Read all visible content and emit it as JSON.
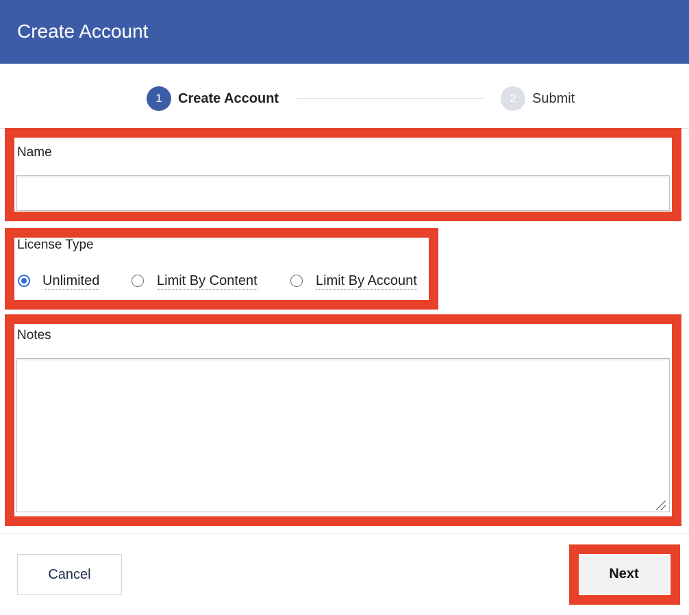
{
  "header": {
    "title": "Create Account"
  },
  "stepper": {
    "steps": [
      {
        "number": "1",
        "label": "Create Account",
        "state": "active"
      },
      {
        "number": "2",
        "label": "Submit",
        "state": "inactive"
      }
    ]
  },
  "form": {
    "name": {
      "label": "Name",
      "value": "",
      "placeholder": ""
    },
    "license_type": {
      "label": "License Type",
      "selected": "Unlimited",
      "options": [
        "Unlimited",
        "Limit By Content",
        "Limit By Account"
      ]
    },
    "notes": {
      "label": "Notes",
      "value": "",
      "placeholder": ""
    }
  },
  "footer": {
    "cancel_label": "Cancel",
    "next_label": "Next"
  },
  "colors": {
    "header_bg": "#3d5ca7",
    "active_step": "#3d5ca7",
    "inactive_step": "#dde0e6",
    "highlight": "#e8412a",
    "radio_selected": "#2f6fe0"
  }
}
